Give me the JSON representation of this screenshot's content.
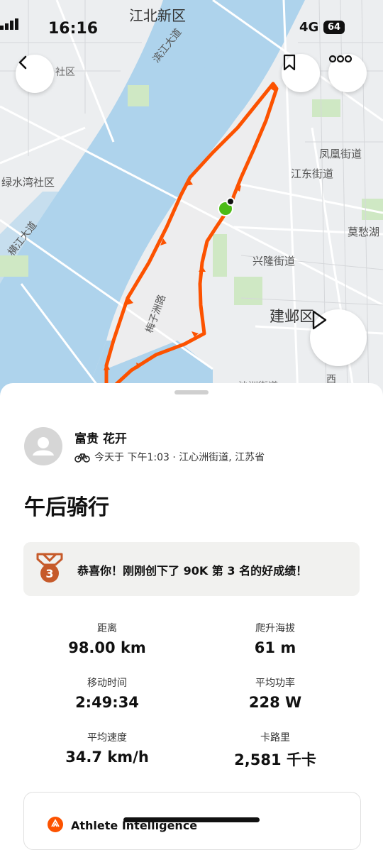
{
  "status_bar": {
    "time": "16:16",
    "network": "4G",
    "battery": "64"
  },
  "map": {
    "labels": {
      "jiangbei": "江北新区",
      "shequ": "社区",
      "binjiang": "滨江大道",
      "lvshuiwan": "绿水湾社区",
      "hengjiang": "横江大道",
      "fenghuang": "凤凰街道",
      "jiangdong": "江东街道",
      "mochou": "莫愁湖",
      "xinglong": "兴隆街道",
      "meizizhou": "梅子洲路",
      "jianye": "建邺区",
      "xi": "西",
      "partial": "沙洲街道"
    },
    "colors": {
      "route": "#fc5200",
      "water": "#aed3ec",
      "start": "#4cbb17"
    }
  },
  "nav": {
    "back_icon": "chevron-left-icon",
    "bookmark_icon": "bookmark-icon",
    "more_icon": "more-icon",
    "play_icon": "play-icon"
  },
  "activity": {
    "athlete_name": "富贵 花开",
    "meta": "今天于 下午1:03 · 江心洲街道, 江苏省",
    "title": "午后骑行",
    "achievement": {
      "rank": "3",
      "text": "恭喜你！刚刚创下了 90K 第 3 名的好成绩！"
    },
    "stats": [
      {
        "label": "距离",
        "value": "98.00 km"
      },
      {
        "label": "爬升海拔",
        "value": "61 m"
      },
      {
        "label": "移动时间",
        "value": "2:49:34"
      },
      {
        "label": "平均功率",
        "value": "228 W"
      },
      {
        "label": "平均速度",
        "value": "34.7 km/h"
      },
      {
        "label": "卡路里",
        "value": "2,581 千卡"
      }
    ],
    "ai_card": {
      "title": "Athlete Intelligence"
    }
  }
}
